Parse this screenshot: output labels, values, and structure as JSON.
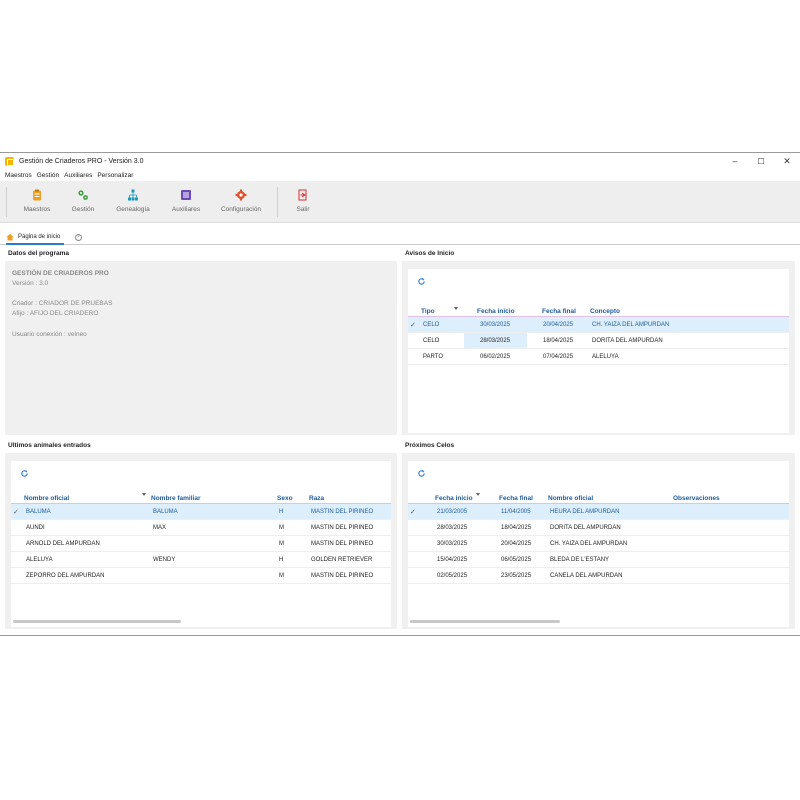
{
  "window": {
    "title": "Gestión de Criaderos PRO  - Versión 3.0",
    "min": "–",
    "max": "☐",
    "close": "✕"
  },
  "menu": [
    "Maestros",
    "Gestión",
    "Auxiliares",
    "Personalizar"
  ],
  "ribbon": [
    {
      "label": "Maestros",
      "icon": "clipboard-icon",
      "color": "#f0a020"
    },
    {
      "label": "Gestión",
      "icon": "gears-icon",
      "color": "#3aa040"
    },
    {
      "label": "Genealogía",
      "icon": "family-tree-icon",
      "color": "#1a9ab8"
    },
    {
      "label": "Auxiliares",
      "icon": "list-icon",
      "color": "#6a4ab8"
    },
    {
      "label": "Configuración",
      "icon": "gear-icon",
      "color": "#e05030"
    },
    {
      "label": "Salir",
      "icon": "exit-icon",
      "color": "#d03030"
    }
  ],
  "tab": {
    "label": "Página de inicio",
    "close": "×"
  },
  "datos": {
    "title": "Datos del programa",
    "name": "GESTIÓN DE CRIADEROS PRO",
    "version": "Versión : 3.0",
    "criador": "Criador : CRIADOR DE PRUEBAS",
    "afijo": "Afijo :     AFIJO DEL CRIADERO",
    "usuario": "Usuario conexión : velneo"
  },
  "avisos": {
    "title": "Avisos de Inicio",
    "headers": [
      "Tipo",
      "Fecha inicio",
      "Fecha final",
      "Concepto"
    ],
    "rows": [
      [
        "CELO",
        "30/03/2025",
        "20/04/2025",
        "CH. YAIZA DEL AMPURDAN"
      ],
      [
        "CELO",
        "28/03/2025",
        "18/04/2025",
        "DORITA DEL AMPURDAN"
      ],
      [
        "PARTO",
        "06/02/2025",
        "07/04/2025",
        "ALELUYA"
      ]
    ]
  },
  "ultimos": {
    "title": "Ultimos animales entrados",
    "headers": [
      "Nombre oficial",
      "Nombre familiar",
      "Sexo",
      "Raza"
    ],
    "rows": [
      [
        "BALUMA",
        "BALUMA",
        "H",
        "MASTIN DEL PIRINEO"
      ],
      [
        "AUNDI",
        "MAX",
        "M",
        "MASTIN DEL PIRINEO"
      ],
      [
        "ARNOLD DEL AMPURDAN",
        "",
        "M",
        "MASTIN DEL PIRINEO"
      ],
      [
        "ALELUYA",
        "WENDY",
        "H",
        "GOLDEN RETRIEVER"
      ],
      [
        "ZEPORRO DEL AMPURDAN",
        "",
        "M",
        "MASTIN DEL PIRINEO"
      ]
    ]
  },
  "proximos": {
    "title": "Próximos Celos",
    "headers": [
      "Fecha inicio",
      "Fecha final",
      "Nombre oficial",
      "Observaciones"
    ],
    "rows": [
      [
        "21/03/2005",
        "11/04/2005",
        "HEURA DEL AMPURDAN",
        ""
      ],
      [
        "28/03/2025",
        "18/04/2025",
        "DORITA DEL AMPURDAN",
        ""
      ],
      [
        "30/03/2025",
        "20/04/2025",
        "CH. YAIZA DEL AMPURDAN",
        ""
      ],
      [
        "15/04/2025",
        "06/05/2025",
        "BLEDA DE L'ESTANY",
        ""
      ],
      [
        "02/05/2025",
        "23/05/2025",
        "CANELA DEL AMPURDAN",
        ""
      ]
    ]
  },
  "check_mark": "✓",
  "colors": {
    "accent": "#1c5c9c",
    "selection": "#ddeefc",
    "panel": "#f0f0f0"
  }
}
